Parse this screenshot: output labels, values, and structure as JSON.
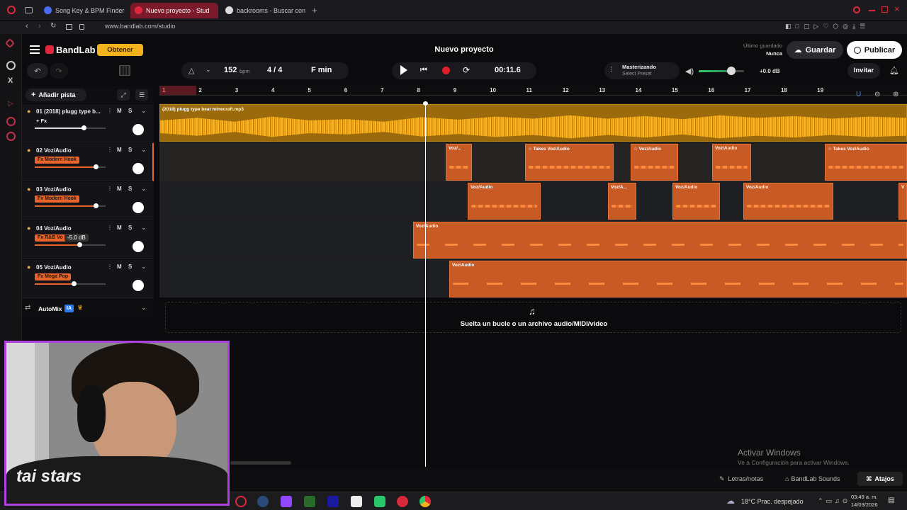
{
  "browser": {
    "tabs": [
      {
        "label": "Song Key & BPM Finder | T"
      },
      {
        "label": "Nuevo proyecto - Stud"
      },
      {
        "label": "backrooms - Buscar con G"
      }
    ],
    "url": "www.bandlab.com/studio"
  },
  "header": {
    "brand": "BandLab",
    "get_button": "Obtener",
    "project_title": "Nuevo proyecto",
    "last_saved_label": "Último guardado",
    "last_saved_value": "Nunca",
    "save_button": "Guardar",
    "publish_button": "Publicar"
  },
  "toolbar": {
    "bpm_value": "152",
    "bpm_unit": "bpm",
    "time_signature": "4 / 4",
    "key": "F min",
    "time": "00:11.6",
    "mastering_label": "Masterizando",
    "mastering_sub": "Select Preset",
    "volume_db": "+0.0 dB",
    "invite_button": "Invitar",
    "volume_level": 0.72
  },
  "tracks_panel": {
    "add_track": "Añadir pista",
    "automix": "AutoMix",
    "automix_badge": "IA"
  },
  "tracks": [
    {
      "name": "01  (2018) plugg type b...",
      "fx": "+ Fx",
      "fx_style": "plain",
      "level": 0.69,
      "muted_label": "M",
      "solo_label": "S"
    },
    {
      "name": "02  Voz/Audio",
      "fx": "Fx Modern Hook",
      "fx_style": "tag",
      "level": 0.86,
      "muted_label": "M",
      "solo_label": "S"
    },
    {
      "name": "03  Voz/Audio",
      "fx": "Fx Modern Hook",
      "fx_style": "tag",
      "level": 0.86,
      "muted_label": "M",
      "solo_label": "S"
    },
    {
      "name": "04  Voz/Audio",
      "fx": "Fx R&B Vo",
      "fx_style": "tag",
      "level": 0.63,
      "muted_label": "M",
      "solo_label": "S",
      "tooltip": "-5.0 dB"
    },
    {
      "name": "05  Voz/Audio",
      "fx": "Fx Mega Pop",
      "fx_style": "tag",
      "level": 0.55,
      "muted_label": "M",
      "solo_label": "S"
    }
  ],
  "ruler": [
    "1",
    "2",
    "3",
    "4",
    "5",
    "6",
    "7",
    "8",
    "9",
    "10",
    "11",
    "12",
    "13",
    "14",
    "15",
    "16",
    "17",
    "18",
    "19"
  ],
  "clips": {
    "master_clip_label": "(2018) plugg type beat minecraft.mp3",
    "voz_label": "Voz/Audio",
    "voz_short": "Voz/...",
    "voz_short2": "Voz/A...",
    "takes_label": "Takes"
  },
  "drop_zone": {
    "text": "Suelta un bucle o un archivo audio/MIDI/video"
  },
  "footer": {
    "lyrics": "Letras/notas",
    "sounds": "BandLab Sounds",
    "shortcuts": "Atajos",
    "activate_title": "Activar Windows",
    "activate_sub": "Ve a Configuración para activar Windows."
  },
  "taskbar": {
    "weather": "18°C  Prac. despejado",
    "time": "03:49 a. m.",
    "date": "14/03/2026"
  },
  "webcam": {
    "shirt_text": "tai stars"
  },
  "colors": {
    "accent_orange": "#e8642c",
    "record_red": "#e01e2e",
    "master_wave": "#f0a818",
    "brand_red": "#e0283c",
    "webcam_border": "#b040e0"
  }
}
